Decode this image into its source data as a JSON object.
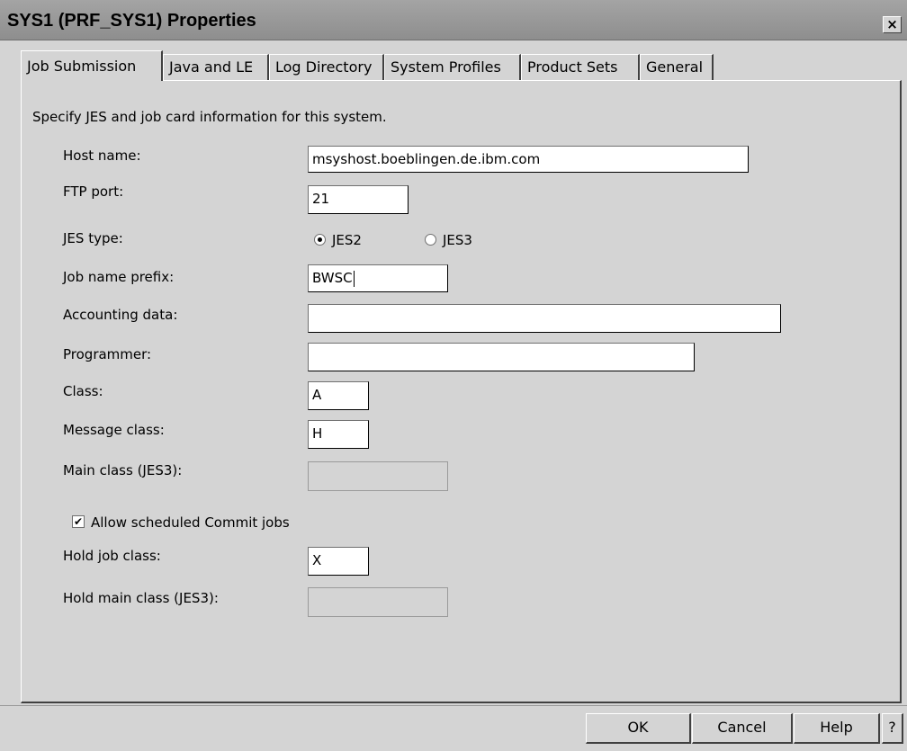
{
  "window": {
    "title": "SYS1 (PRF_SYS1) Properties",
    "close_label": "×"
  },
  "tabs": [
    {
      "label": "Job Submission",
      "active": true
    },
    {
      "label": "Java and LE"
    },
    {
      "label": "Log Directory"
    },
    {
      "label": "System Profiles"
    },
    {
      "label": "Product Sets"
    },
    {
      "label": "General"
    }
  ],
  "panel": {
    "description": "Specify JES and job card information for this system."
  },
  "form": {
    "host_name": {
      "label": "Host name:",
      "value": "msyshost.boeblingen.de.ibm.com"
    },
    "ftp_port": {
      "label": "FTP port:",
      "value": "21"
    },
    "jes_type": {
      "label": "JES type:",
      "options": [
        "JES2",
        "JES3"
      ],
      "selected": "JES2"
    },
    "job_name_prefix": {
      "label": "Job name prefix:",
      "value": "BWSC"
    },
    "accounting_data": {
      "label": "Accounting data:",
      "value": ""
    },
    "programmer": {
      "label": "Programmer:",
      "value": ""
    },
    "class": {
      "label": "Class:",
      "value": "A"
    },
    "message_class": {
      "label": "Message class:",
      "value": "H"
    },
    "main_class": {
      "label": "Main class (JES3):",
      "value": "",
      "enabled": false
    },
    "allow_commit": {
      "label": "Allow scheduled Commit jobs",
      "checked": true
    },
    "hold_job_class": {
      "label": "Hold job class:",
      "value": "X"
    },
    "hold_main_class": {
      "label": "Hold main class (JES3):",
      "value": "",
      "enabled": false
    }
  },
  "buttons": {
    "ok": "OK",
    "cancel": "Cancel",
    "help": "Help",
    "question": "?"
  }
}
